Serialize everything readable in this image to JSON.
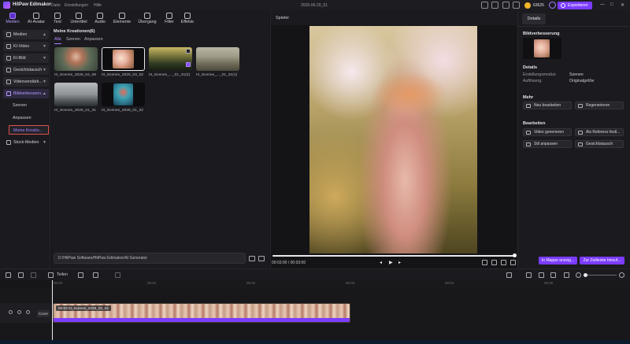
{
  "titlebar": {
    "app_name": "HitPaw Edimakor",
    "menu": [
      "Datei",
      "Einstellungen",
      "Hilfe"
    ],
    "doc_title": "2026-06-29_01",
    "coins": "63625",
    "export_label": "Exportieren",
    "window_controls": [
      "—",
      "□",
      "✕"
    ]
  },
  "toolbar": {
    "tools": [
      {
        "label": "Medien",
        "icon": "media-icon"
      },
      {
        "label": "AI-Avatar",
        "icon": "avatar-icon"
      },
      {
        "label": "Text",
        "icon": "text-icon"
      },
      {
        "label": "Untertitel",
        "icon": "subtitle-icon"
      },
      {
        "label": "Audio",
        "icon": "audio-icon"
      },
      {
        "label": "Elemente",
        "icon": "elements-icon"
      },
      {
        "label": "Übergang",
        "icon": "transition-icon"
      },
      {
        "label": "Filter",
        "icon": "filter-icon"
      },
      {
        "label": "Effekte",
        "icon": "effects-icon"
      }
    ]
  },
  "sidebar": {
    "items": [
      {
        "label": "Medien"
      },
      {
        "label": "KI-Video"
      },
      {
        "label": "KI-Bild"
      },
      {
        "label": "Gesichtstausch"
      },
      {
        "label": "Videoverstärk..."
      },
      {
        "label": "Bildverbessern..."
      }
    ],
    "sub_items": [
      {
        "label": "Szenen"
      },
      {
        "label": "Anpassen"
      },
      {
        "label": "Meine Kreatio..."
      }
    ],
    "stock": {
      "label": "Stock-Medien"
    }
  },
  "media": {
    "header": "Meine Kreationen(6)",
    "filters": [
      "Alle",
      "Szenen",
      "Anpassen"
    ],
    "thumbs": [
      {
        "caption": "III_Scenes_2026_04_09"
      },
      {
        "caption": "III_Scenes_2026_03_02"
      },
      {
        "caption": "III_Scenes_..._01_31(2)"
      },
      {
        "caption": "III_Scenes_..._01_31(1)"
      },
      {
        "caption": "III_Scenes_2026_01_31"
      },
      {
        "caption": "III_Scenes_2026_01_22"
      }
    ],
    "path": "D:/HitPaw Software/HitPaw Edimakor/AI Generator"
  },
  "player": {
    "header": "Spieler",
    "time": "00:03:00 / 00:03:00",
    "progress": 1.0
  },
  "details": {
    "tab": "Details",
    "enhance_title": "Bildverbesserung",
    "details_title": "Details",
    "rows": [
      {
        "key": "Erstellungsmodus:",
        "value": "Szenen"
      },
      {
        "key": "Auflösung:",
        "value": "Originalgröße"
      }
    ],
    "more_title": "Mehr",
    "more_buttons": [
      {
        "label": "Neu bearbeiten",
        "icon": "edit-icon"
      },
      {
        "label": "Regenerieren",
        "icon": "refresh-icon"
      }
    ],
    "edit_title": "Bearbeiten",
    "edit_buttons": [
      {
        "label": "Video generieren",
        "icon": "video-icon"
      },
      {
        "label": "Als Referenz festl...",
        "icon": "reference-icon"
      },
      {
        "label": "Stil anpassen",
        "icon": "style-icon"
      },
      {
        "label": "Gesichtstausch",
        "icon": "face-icon"
      }
    ],
    "footer_buttons": [
      "In Mappe anzeig...",
      "Zur Zeitleiste hinzuf..."
    ]
  },
  "timeline": {
    "split_label": "Teilen",
    "ruler": [
      "00:00",
      "00:01",
      "00:02",
      "00:03",
      "00:04",
      "00:05"
    ],
    "track_cover": "Cover",
    "clip_name": "00:03 III_Scenes_2026_03_02"
  }
}
